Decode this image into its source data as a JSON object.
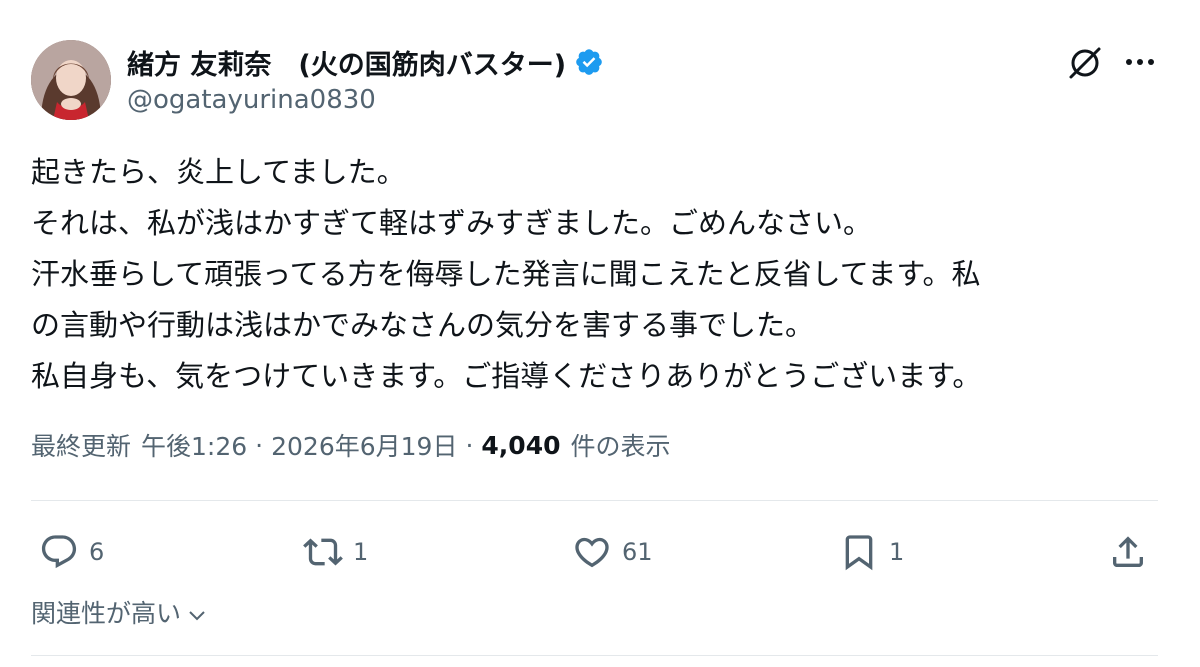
{
  "author": {
    "display_name": "緒方 友莉奈　(火の国筋肉バスター)",
    "handle": "@ogatayurina0830",
    "verified": true,
    "verified_color": "#1d9bf0",
    "avatar_icon": "profile-photo"
  },
  "header_icons": {
    "grok": "grok-icon",
    "more": "more-icon"
  },
  "tweet": {
    "lines": [
      "起きたら、炎上してました。",
      "それは、私が浅はかすぎて軽はずみすぎました。ごめんなさい。",
      "汗水垂らして頑張ってる方を侮辱した発言に聞こえたと反省してます。私",
      "の言動や行動は浅はかでみなさんの気分を害する事でした。",
      "私自身も、気をつけていきます。ご指導くださりありがとうございます。"
    ]
  },
  "meta": {
    "edited_label": "最終更新",
    "time": "午後1:26",
    "separator": "·",
    "date": "2026年6月19日",
    "views_count": "4,040",
    "views_label": "件の表示"
  },
  "actions": {
    "replies": "6",
    "reposts": "1",
    "likes": "61",
    "bookmarks": "1"
  },
  "replies_sort": {
    "label": "関連性が高い"
  },
  "colors": {
    "text": "#0f1419",
    "secondary": "#536471",
    "divider": "#e4e8eb"
  }
}
